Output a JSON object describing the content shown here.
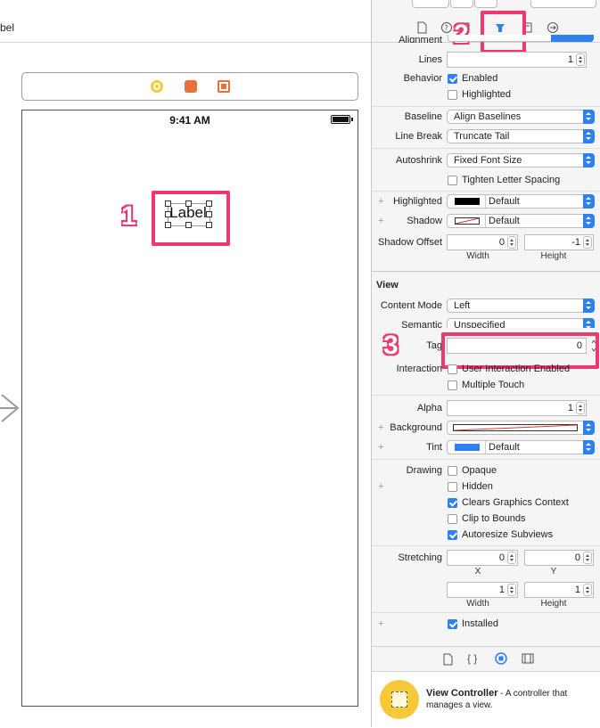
{
  "canvas": {
    "breadcrumb": "bel",
    "status_time": "9:41 AM",
    "label_text": "Label",
    "annotations": [
      "1",
      "2",
      "3"
    ]
  },
  "inspector": {
    "alignment_label": "Alignment",
    "lines_label": "Lines",
    "lines_value": "1",
    "behavior_label": "Behavior",
    "behavior_enabled": "Enabled",
    "behavior_highlighted": "Highlighted",
    "baseline_label": "Baseline",
    "baseline_value": "Align Baselines",
    "linebreak_label": "Line Break",
    "linebreak_value": "Truncate Tail",
    "autoshrink_label": "Autoshrink",
    "autoshrink_value": "Fixed Font Size",
    "tighten": "Tighten Letter Spacing",
    "highlighted_label": "Highlighted",
    "highlighted_value": "Default",
    "shadow_label": "Shadow",
    "shadow_value": "Default",
    "shadow_offset_label": "Shadow Offset",
    "shadow_offset_w": "0",
    "shadow_offset_h": "-1",
    "width_label": "Width",
    "height_label": "Height",
    "view_section": "View",
    "content_mode_label": "Content Mode",
    "content_mode_value": "Left",
    "semantic_label": "Semantic",
    "semantic_value": "Unspecified",
    "tag_label": "Tag",
    "tag_value": "0",
    "interaction_label": "Interaction",
    "user_interaction": "User Interaction Enabled",
    "multiple_touch": "Multiple Touch",
    "alpha_label": "Alpha",
    "alpha_value": "1",
    "background_label": "Background",
    "tint_label": "Tint",
    "tint_value": "Default",
    "drawing_label": "Drawing",
    "opaque": "Opaque",
    "hidden": "Hidden",
    "clears_graphics": "Clears Graphics Context",
    "clip_bounds": "Clip to Bounds",
    "autoresize": "Autoresize Subviews",
    "stretching_label": "Stretching",
    "stretch_x": "0",
    "stretch_y": "0",
    "stretch_w": "1",
    "stretch_h": "1",
    "x_label": "X",
    "y_label": "Y",
    "installed": "Installed"
  },
  "library": {
    "title": "View Controller",
    "desc_dash": " - A controller that",
    "desc_line2": "manages a view."
  },
  "colors": {
    "accent": "#2d80f0",
    "highlight": "#ee3870",
    "vc_yellow": "#f6c93a"
  }
}
